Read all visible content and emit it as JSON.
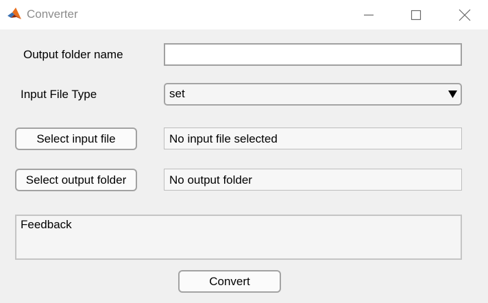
{
  "window": {
    "title": "Converter",
    "icon": "matlab-logo-icon",
    "controls": [
      "minimize-icon",
      "maximize-icon",
      "close-icon"
    ]
  },
  "form": {
    "output_folder_label": "Output folder name",
    "output_folder_value": "",
    "input_type_label": "Input File Type",
    "input_type_selected": "set",
    "select_input_button": "Select input file",
    "input_file_status": "No input file selected",
    "select_output_button": "Select output folder",
    "output_folder_status": "No output folder",
    "feedback_text": "Feedback",
    "convert_button": "Convert"
  }
}
